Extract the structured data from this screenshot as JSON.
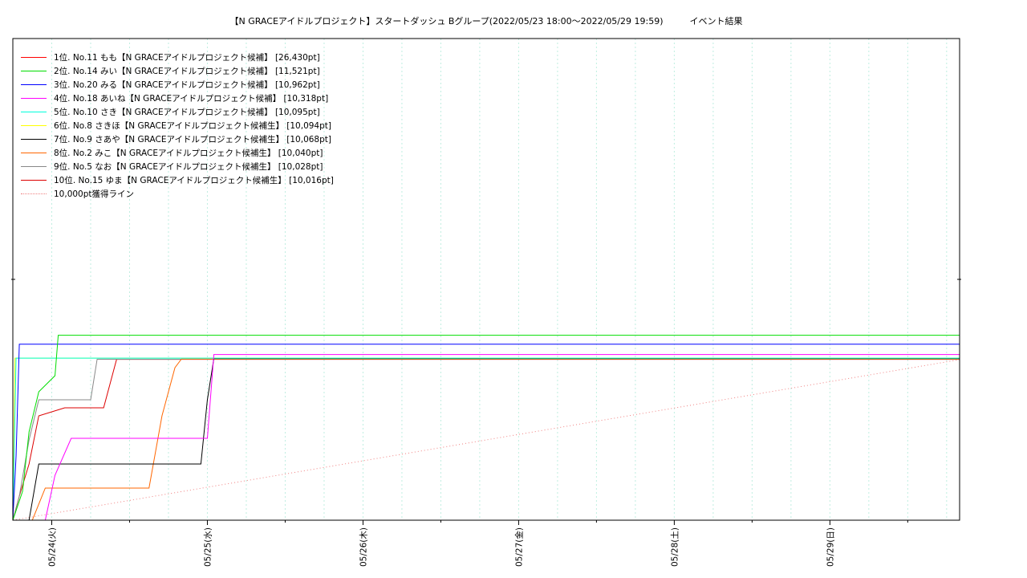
{
  "chart_data": {
    "type": "line",
    "title": "【N GRACEアイドルプロジェクト】スタートダッシュ Bグループ(2022/05/23 18:00〜2022/05/29 19:59)　　　イベント結果",
    "x_range": [
      "2022-05-23 18:00",
      "2022-05-29 20:00"
    ],
    "y_range": [
      0,
      30000
    ],
    "grid": true,
    "legend_position": "top-left",
    "x_ticks": [
      "05/24(火)",
      "05/25(水)",
      "05/26(木)",
      "05/27(金)",
      "05/28(土)",
      "05/29(日)"
    ],
    "reference_line": {
      "name": "10,000pt獲得ライン",
      "color": "#f08080",
      "points": [
        [
          "2022-05-23 18:00",
          0
        ],
        [
          "2022-05-29 20:00",
          10000
        ]
      ]
    },
    "series": [
      {
        "name": "1位. No.11 もも【N GRACEアイドルプロジェクト候補】 [26,430pt]",
        "color": "#ff0000",
        "points": [
          [
            "2022-05-23 18:00",
            0
          ],
          [
            "2022-05-29 19:59",
            0
          ]
        ]
      },
      {
        "name": "2位. No.14 みい【N GRACEアイドルプロジェクト候補】 [11,521pt]",
        "color": "#00dd00",
        "points": [
          [
            "2022-05-23 18:00",
            0
          ],
          [
            "2022-05-23 19:30",
            1800
          ],
          [
            "2022-05-23 20:30",
            5500
          ],
          [
            "2022-05-23 22:00",
            8000
          ],
          [
            "2022-05-24 00:30",
            9000
          ],
          [
            "2022-05-24 01:00",
            11521
          ],
          [
            "2022-05-29 19:59",
            11521
          ]
        ]
      },
      {
        "name": "3位. No.20 みる【N GRACEアイドルプロジェクト候補】 [10,962pt]",
        "color": "#0000ff",
        "points": [
          [
            "2022-05-23 18:00",
            0
          ],
          [
            "2022-05-23 18:30",
            4000
          ],
          [
            "2022-05-23 19:00",
            10962
          ],
          [
            "2022-05-29 19:59",
            10962
          ]
        ]
      },
      {
        "name": "4位. No.18 あいね【N GRACEアイドルプロジェクト候補】 [10,318pt]",
        "color": "#ff00ff",
        "points": [
          [
            "2022-05-23 18:00",
            0
          ],
          [
            "2022-05-23 23:00",
            0
          ],
          [
            "2022-05-24 00:30",
            2800
          ],
          [
            "2022-05-24 03:00",
            5100
          ],
          [
            "2022-05-25 00:00",
            5100
          ],
          [
            "2022-05-25 01:00",
            10318
          ],
          [
            "2022-05-29 19:59",
            10318
          ]
        ]
      },
      {
        "name": "5位. No.10 さき【N GRACEアイドルプロジェクト候補】 [10,095pt]",
        "color": "#00ffdd",
        "points": [
          [
            "2022-05-23 18:00",
            0
          ],
          [
            "2022-05-23 18:30",
            10095
          ],
          [
            "2022-05-29 19:59",
            10095
          ]
        ]
      },
      {
        "name": "6位. No.8 さきほ【N GRACEアイドルプロジェクト候補生】 [10,094pt]",
        "color": "#ffff00",
        "points": [
          [
            "2022-05-23 18:00",
            0
          ],
          [
            "2022-05-23 18:20",
            10094
          ],
          [
            "2022-05-29 19:59",
            10094
          ]
        ]
      },
      {
        "name": "7位. No.9 さあや【N GRACEアイドルプロジェクト候補生】 [10,068pt]",
        "color": "#000000",
        "points": [
          [
            "2022-05-23 18:00",
            0
          ],
          [
            "2022-05-23 20:30",
            0
          ],
          [
            "2022-05-23 22:00",
            3500
          ],
          [
            "2022-05-24 23:00",
            3500
          ],
          [
            "2022-05-25 00:00",
            7500
          ],
          [
            "2022-05-25 01:00",
            10068
          ],
          [
            "2022-05-29 19:59",
            10068
          ]
        ]
      },
      {
        "name": "8位. No.2 みこ【N GRACEアイドルプロジェクト候補生】 [10,040pt]",
        "color": "#ff6600",
        "points": [
          [
            "2022-05-23 18:00",
            0
          ],
          [
            "2022-05-23 21:00",
            0
          ],
          [
            "2022-05-23 23:00",
            2000
          ],
          [
            "2022-05-24 15:00",
            2000
          ],
          [
            "2022-05-24 17:00",
            6500
          ],
          [
            "2022-05-24 19:00",
            9500
          ],
          [
            "2022-05-24 20:00",
            10040
          ],
          [
            "2022-05-29 19:59",
            10040
          ]
        ]
      },
      {
        "name": "9位. No.5 なお【N GRACEアイドルプロジェクト候補生】 [10,028pt]",
        "color": "#888888",
        "points": [
          [
            "2022-05-23 18:00",
            0
          ],
          [
            "2022-05-23 19:00",
            1500
          ],
          [
            "2022-05-23 20:30",
            5000
          ],
          [
            "2022-05-23 22:00",
            7500
          ],
          [
            "2022-05-24 06:00",
            7500
          ],
          [
            "2022-05-24 07:00",
            10028
          ],
          [
            "2022-05-29 19:59",
            10028
          ]
        ]
      },
      {
        "name": "10位. No.15 ゆま【N GRACEアイドルプロジェクト候補生】 [10,016pt]",
        "color": "#dd0000",
        "points": [
          [
            "2022-05-23 18:00",
            0
          ],
          [
            "2022-05-23 19:00",
            1500
          ],
          [
            "2022-05-23 20:30",
            3500
          ],
          [
            "2022-05-23 22:00",
            6500
          ],
          [
            "2022-05-24 02:00",
            7000
          ],
          [
            "2022-05-24 08:00",
            7000
          ],
          [
            "2022-05-24 10:00",
            10016
          ],
          [
            "2022-05-29 19:59",
            10016
          ]
        ]
      }
    ]
  }
}
